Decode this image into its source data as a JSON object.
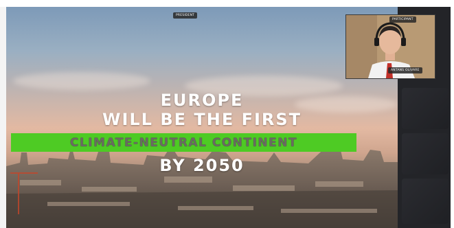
{
  "meeting": {
    "president_label": "PRESIDENT",
    "participant_label": "PARTICIPANT",
    "speaker_name": "ANTANS OLIVARE"
  },
  "slide": {
    "line1": "EUROPE",
    "line2": "WILL BE THE FIRST",
    "line3": "CLIMATE-NEUTRAL CONTINENT",
    "line4": "BY 2050"
  },
  "colors": {
    "banner_green": "#4ecb24",
    "background": "#1a1b1e"
  }
}
